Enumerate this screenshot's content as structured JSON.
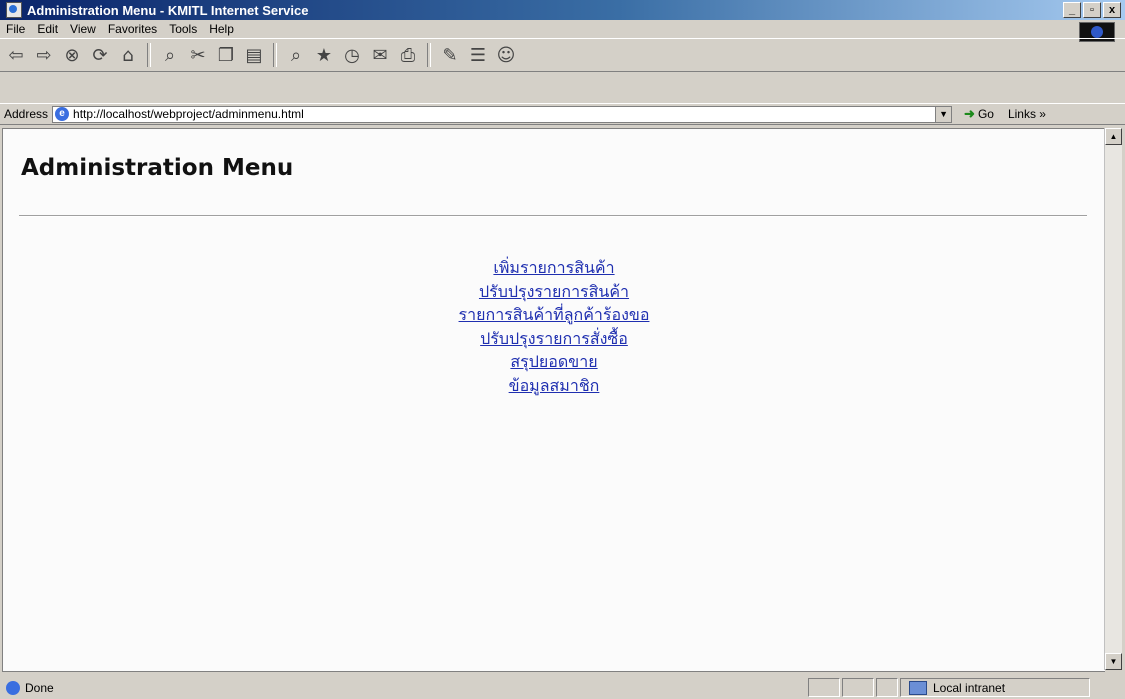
{
  "window": {
    "title": "Administration Menu - KMITL Internet Service",
    "controls": [
      "_",
      "▫",
      "x"
    ]
  },
  "menubar": {
    "items": [
      "File",
      "Edit",
      "View",
      "Favorites",
      "Tools",
      "Help"
    ]
  },
  "toolbar": {
    "icons": [
      "back-icon",
      "forward-icon",
      "stop-icon",
      "refresh-icon",
      "home-icon",
      "search-icon",
      "cut-icon",
      "copy-icon",
      "paste-icon",
      "find-icon",
      "favorites-icon",
      "history-icon",
      "mail-icon",
      "print-icon",
      "edit-icon",
      "discuss-icon",
      "messenger-icon"
    ]
  },
  "addressbar": {
    "label": "Address",
    "url": "http://localhost/webproject/adminmenu.html",
    "go_label": "Go",
    "links_label": "Links »"
  },
  "page": {
    "title": "Administration Menu",
    "links": [
      "เพิ่มรายการสินค้า",
      "ปรับปรุงรายการสินค้า",
      "รายการสินค้าที่ลูกค้าร้องขอ",
      "ปรับปรุงรายการสั่งซื้อ",
      "สรุปยอดขาย",
      "ข้อมูลสมาชิก"
    ]
  },
  "statusbar": {
    "status": "Done",
    "zone": "Local intranet"
  },
  "colors": {
    "link": "#1f2fb0",
    "titlebar_start": "#0a246a",
    "titlebar_end": "#a6caf0",
    "chrome": "#d4d0c8"
  }
}
